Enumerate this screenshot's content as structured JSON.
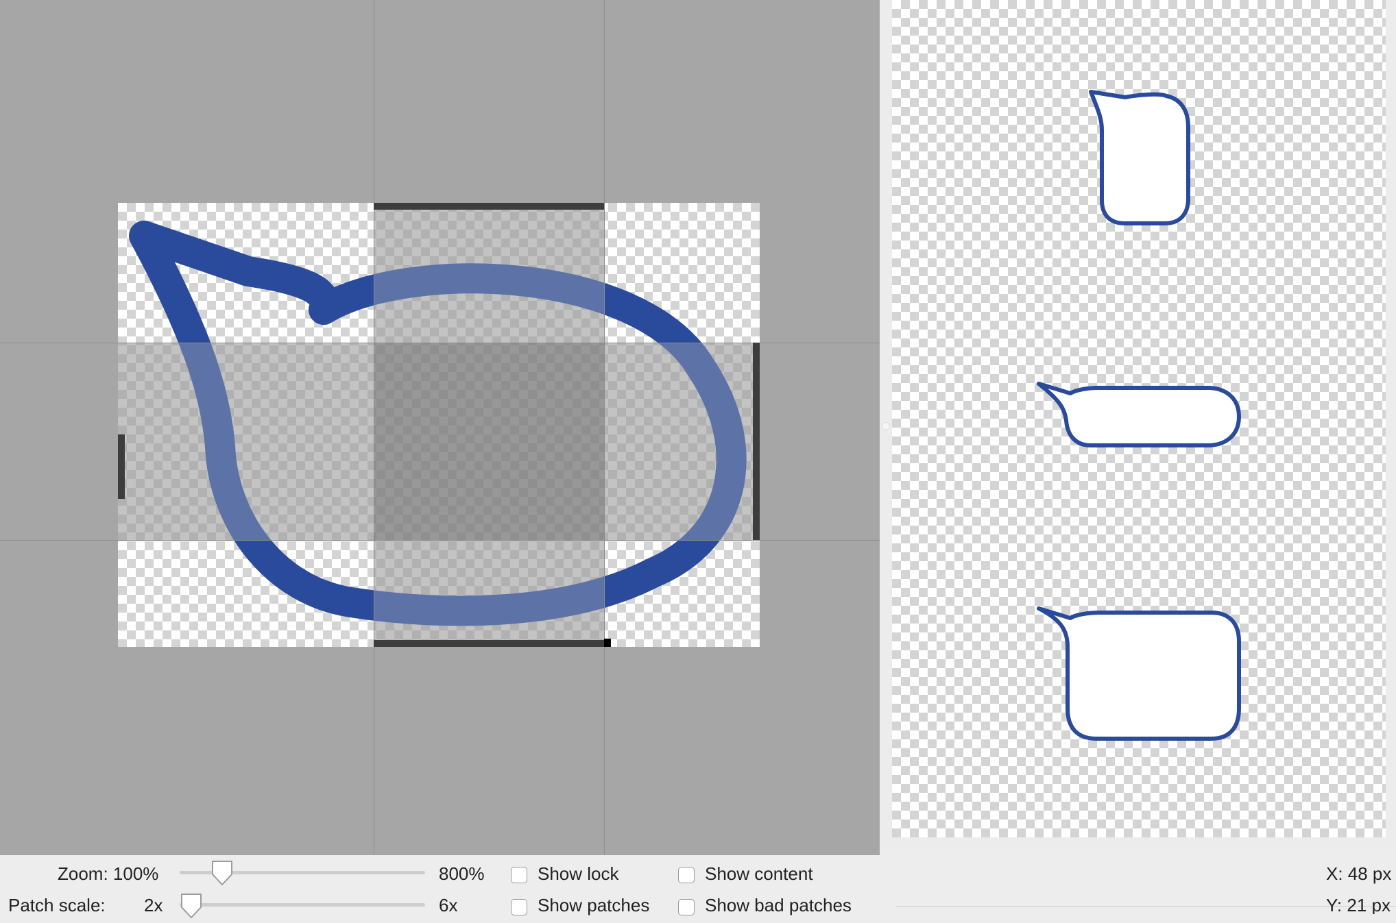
{
  "toolbar": {
    "zoom_label": "Zoom: 100%",
    "zoom_max": "800%",
    "zoom_value": 0.14,
    "patch_scale_label": "Patch scale:",
    "patch_scale_min": "2x",
    "patch_scale_max": "6x",
    "patch_scale_value": 0.0,
    "checkboxes": [
      {
        "label": "Show lock",
        "checked": false
      },
      {
        "label": "Show content",
        "checked": false
      },
      {
        "label": "Show patches",
        "checked": false
      },
      {
        "label": "Show bad patches",
        "checked": false
      }
    ]
  },
  "coordinates": {
    "x": "X: 48 px",
    "y": "Y: 21 px"
  },
  "colors": {
    "stroke": "#2a4a9b",
    "editor_background": "#a6a6a6",
    "patch_marker": "#3d3d3d"
  },
  "icons": [
    "slider-thumb-icon",
    "speech-bubble-image"
  ]
}
